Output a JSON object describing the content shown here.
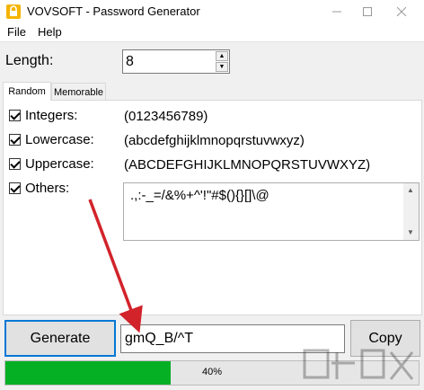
{
  "window": {
    "title": "VOVSOFT - Password Generator",
    "min_icon": "minimize-icon",
    "max_icon": "maximize-icon",
    "close_icon": "close-icon"
  },
  "menu": {
    "items": [
      {
        "label": "File"
      },
      {
        "label": "Help"
      }
    ]
  },
  "length": {
    "label": "Length:",
    "value": "8"
  },
  "tabs": [
    {
      "label": "Random",
      "active": true
    },
    {
      "label": "Memorable",
      "active": false
    }
  ],
  "options": {
    "integers": {
      "label": "Integers:",
      "checked": true,
      "chars": "(0123456789)"
    },
    "lowercase": {
      "label": "Lowercase:",
      "checked": true,
      "chars": "(abcdefghijklmnopqrstuvwxyz)"
    },
    "uppercase": {
      "label": "Uppercase:",
      "checked": true,
      "chars": "(ABCDEFGHIJKLMNOPQRSTUVWXYZ)"
    },
    "others": {
      "label": "Others:",
      "checked": true,
      "chars": ".,:-_=/&%+^'!\"#$(){}[]\\@"
    }
  },
  "actions": {
    "generate_label": "Generate",
    "copy_label": "Copy"
  },
  "password": {
    "value": "gmQ_B/^T"
  },
  "progress": {
    "percent": 40,
    "text": "40%",
    "color": "#06b025"
  },
  "colors": {
    "focus_border": "#0078d7",
    "arrow": "#d2232a"
  }
}
